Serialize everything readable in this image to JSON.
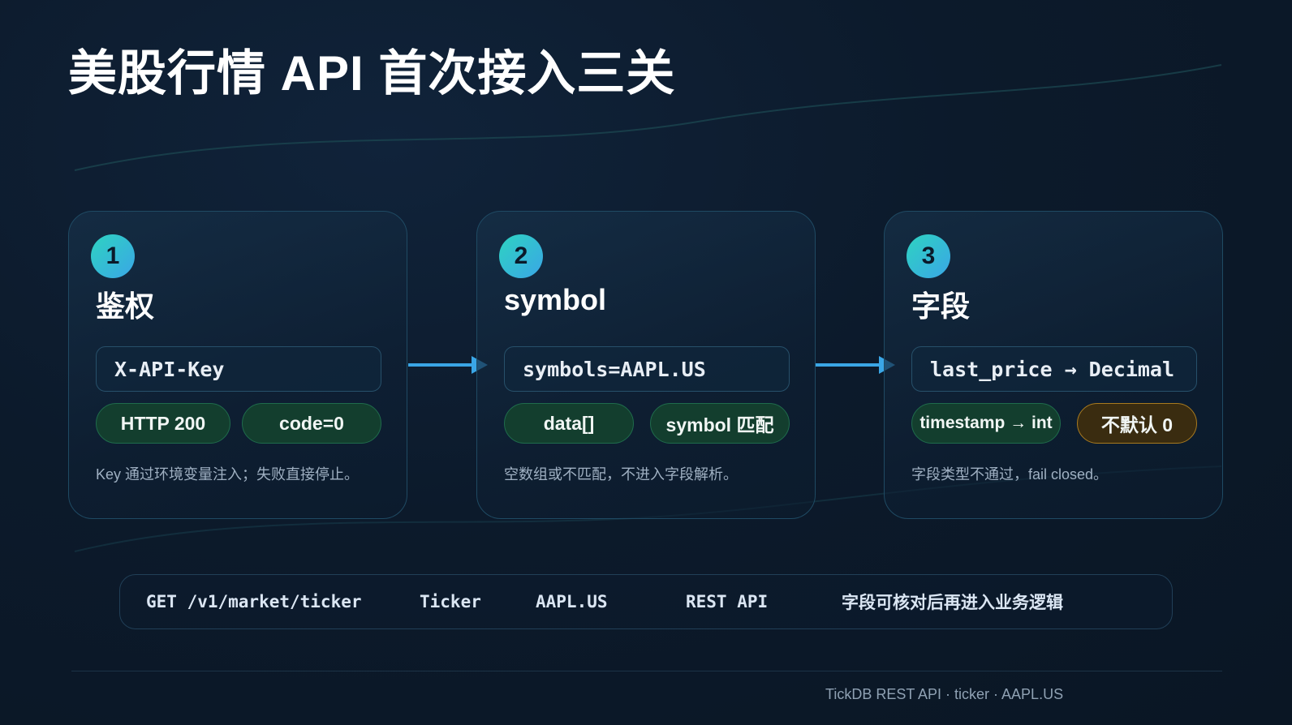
{
  "title": "美股行情 API 首次接入三关",
  "steps": [
    {
      "number": "1",
      "title": "鉴权",
      "code": "X-API-Key",
      "pills": [
        {
          "label": "HTTP 200",
          "style": "green"
        },
        {
          "label": "code=0",
          "style": "green"
        }
      ],
      "note": "Key 通过环境变量注入；失败直接停止。"
    },
    {
      "number": "2",
      "title": "symbol",
      "code": "symbols=AAPL.US",
      "pills": [
        {
          "label": "data[]",
          "style": "green"
        },
        {
          "label": "symbol 匹配",
          "style": "green"
        }
      ],
      "note": "空数组或不匹配，不进入字段解析。"
    },
    {
      "number": "3",
      "title": "字段",
      "code": "last_price → Decimal",
      "pills": [
        {
          "label": "timestamp → int",
          "style": "green"
        },
        {
          "label": "不默认 0",
          "style": "amber"
        }
      ],
      "note": "字段类型不通过，fail closed。"
    }
  ],
  "bottom_bar": {
    "endpoint": "GET /v1/market/ticker",
    "resource": "Ticker",
    "symbol": "AAPL.US",
    "api_type": "REST API",
    "summary": "字段可核对后再进入业务逻辑"
  },
  "footer": "TickDB REST API · ticker · AAPL.US",
  "colors": {
    "background": "#0c1a2b",
    "accent_arrow": "#3aa6e6",
    "badge_gradient_start": "#2ed3c1",
    "badge_gradient_end": "#3aa6e6",
    "pill_green": "#133e2e",
    "pill_amber": "#3a2c10"
  }
}
